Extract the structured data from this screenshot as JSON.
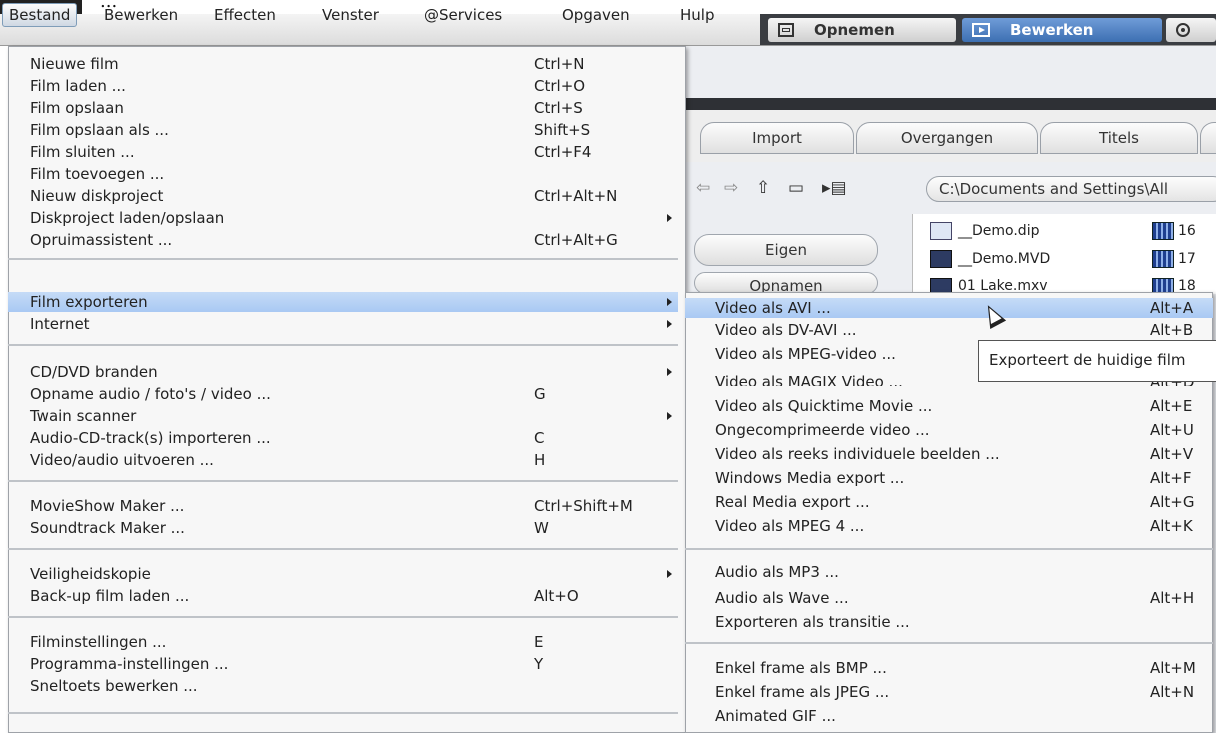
{
  "window_title": "...",
  "menubar": [
    "Bestand",
    "Bewerken",
    "Effecten",
    "Venster",
    "@Services",
    "Opgaven",
    "Hulp"
  ],
  "mode_buttons": {
    "record": "Opnemen",
    "edit": "Bewerken"
  },
  "bg": {
    "tabs": [
      "Import",
      "Overgangen",
      "Titels"
    ],
    "path": "C:\\Documents and Settings\\All",
    "pills": [
      "Eigen",
      "Opnamen"
    ],
    "files": [
      "__Demo.dip",
      "__Demo.MVD",
      "01 Lake.mxv"
    ],
    "file_numbers": [
      "16",
      "17",
      "18"
    ]
  },
  "menu": {
    "items": [
      {
        "label": "Nieuwe film",
        "shortcut": "Ctrl+N"
      },
      {
        "label": "Film laden ...",
        "shortcut": "Ctrl+O"
      },
      {
        "label": "Film opslaan",
        "shortcut": "Ctrl+S"
      },
      {
        "label": "Film opslaan als ...",
        "shortcut": "Shift+S"
      },
      {
        "label": "Film sluiten ...",
        "shortcut": "Ctrl+F4"
      },
      {
        "label": "Film toevoegen ...",
        "shortcut": ""
      },
      {
        "label": "Nieuw diskproject",
        "shortcut": "Ctrl+Alt+N"
      },
      {
        "label": "Diskproject laden/opslaan",
        "shortcut": ""
      },
      {
        "label": "Opruimassistent ...",
        "shortcut": "Ctrl+Alt+G"
      },
      {
        "label": "Film exporteren",
        "shortcut": ""
      },
      {
        "label": "Internet",
        "shortcut": ""
      },
      {
        "label": "CD/DVD branden",
        "shortcut": ""
      },
      {
        "label": "Opname audio / foto's / video ...",
        "shortcut": "G"
      },
      {
        "label": "Twain scanner",
        "shortcut": ""
      },
      {
        "label": "Audio-CD-track(s) importeren ...",
        "shortcut": "C"
      },
      {
        "label": "Video/audio uitvoeren ...",
        "shortcut": "H"
      },
      {
        "label": "MovieShow Maker ...",
        "shortcut": "Ctrl+Shift+M"
      },
      {
        "label": "Soundtrack Maker ...",
        "shortcut": "W"
      },
      {
        "label": "Veiligheidskopie",
        "shortcut": ""
      },
      {
        "label": "Back-up film laden ...",
        "shortcut": "Alt+O"
      },
      {
        "label": "Filminstellingen ...",
        "shortcut": "E"
      },
      {
        "label": "Programma-instellingen ...",
        "shortcut": "Y"
      },
      {
        "label": "Sneltoets bewerken ...",
        "shortcut": ""
      }
    ]
  },
  "submenu": {
    "items": [
      {
        "label": "Video als AVI ...",
        "shortcut": "Alt+A"
      },
      {
        "label": "Video als DV-AVI ...",
        "shortcut": "Alt+B"
      },
      {
        "label": "Video als MPEG-video ...",
        "shortcut": ""
      },
      {
        "label": "Video als MAGIX Video ...",
        "shortcut": "Alt+D"
      },
      {
        "label": "Video als Quicktime Movie ...",
        "shortcut": "Alt+E"
      },
      {
        "label": "Ongecomprimeerde video ...",
        "shortcut": "Alt+U"
      },
      {
        "label": "Video als reeks individuele beelden ...",
        "shortcut": "Alt+V"
      },
      {
        "label": "Windows Media export ...",
        "shortcut": "Alt+F"
      },
      {
        "label": "Real Media export ...",
        "shortcut": "Alt+G"
      },
      {
        "label": "Video als MPEG 4 ...",
        "shortcut": "Alt+K"
      },
      {
        "label": "Audio als MP3 ...",
        "shortcut": ""
      },
      {
        "label": "Audio als Wave ...",
        "shortcut": "Alt+H"
      },
      {
        "label": "Exporteren als transitie ...",
        "shortcut": ""
      },
      {
        "label": "Enkel frame als BMP ...",
        "shortcut": "Alt+M"
      },
      {
        "label": "Enkel frame als JPEG ...",
        "shortcut": "Alt+N"
      },
      {
        "label": "Animated GIF ...",
        "shortcut": ""
      }
    ]
  },
  "tooltip": "Exporteert de huidige film"
}
